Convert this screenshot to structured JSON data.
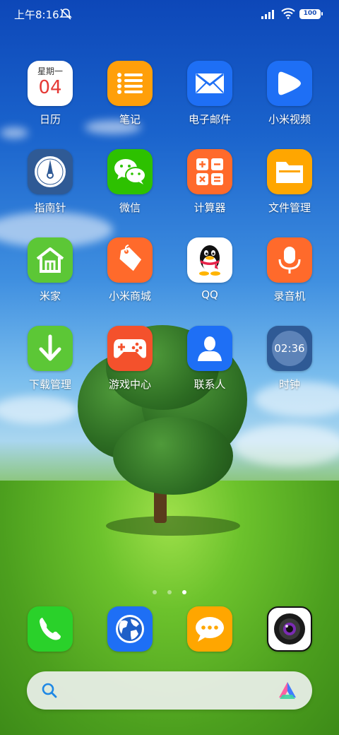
{
  "status_bar": {
    "time": "上午8:16",
    "battery": "100"
  },
  "apps": [
    {
      "name": "calendar",
      "label": "日历",
      "weekday": "星期一",
      "day": "04"
    },
    {
      "name": "notes",
      "label": "笔记"
    },
    {
      "name": "email",
      "label": "电子邮件"
    },
    {
      "name": "mi-video",
      "label": "小米视频"
    },
    {
      "name": "compass",
      "label": "指南针"
    },
    {
      "name": "wechat",
      "label": "微信"
    },
    {
      "name": "calculator",
      "label": "计算器"
    },
    {
      "name": "file-manager",
      "label": "文件管理"
    },
    {
      "name": "mi-home",
      "label": "米家"
    },
    {
      "name": "mi-store",
      "label": "小米商城"
    },
    {
      "name": "qq",
      "label": "QQ"
    },
    {
      "name": "recorder",
      "label": "录音机"
    },
    {
      "name": "download-manager",
      "label": "下载管理"
    },
    {
      "name": "game-center",
      "label": "游戏中心"
    },
    {
      "name": "contacts",
      "label": "联系人"
    },
    {
      "name": "clock",
      "label": "时钟",
      "time": "02:36"
    }
  ],
  "dock": [
    {
      "name": "phone",
      "icon": "phone-icon"
    },
    {
      "name": "browser",
      "icon": "globe-icon"
    },
    {
      "name": "messages",
      "icon": "message-icon"
    },
    {
      "name": "camera",
      "icon": "camera-icon"
    }
  ],
  "page_indicator": {
    "pages": 3,
    "current": 3
  },
  "colors": {
    "calendar_red": "#e53935",
    "notes_orange": "#ff9f0a",
    "email_blue": "#1e6ff5",
    "wechat_green": "#2dc100",
    "mi_orange": "#ff6a2b"
  }
}
